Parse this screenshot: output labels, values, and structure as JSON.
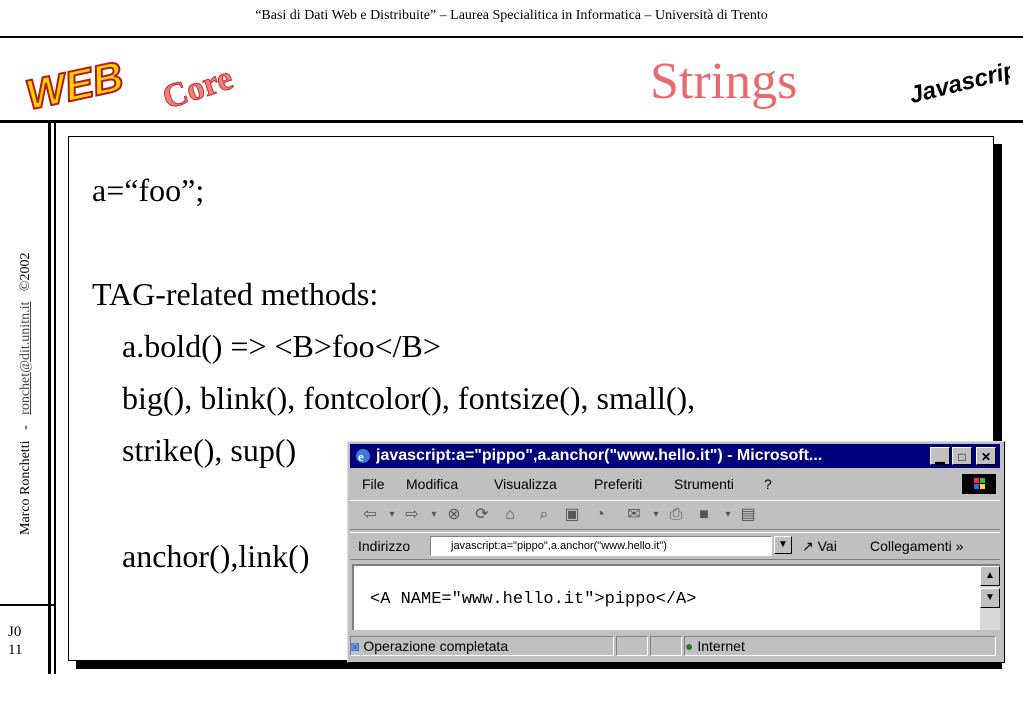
{
  "header": {
    "course_title": "“Basi di Dati Web e Distribuite” – Laurea Specialitica in Informatica – Università di Trento",
    "logo_web": "WEB",
    "logo_core": "Core",
    "slide_title": "Strings",
    "logo_javascript": "Javascript"
  },
  "sidebar": {
    "author": "Marco Ronchetti",
    "separator": "-",
    "email": "ronchet@dit.unitn.it",
    "copyright": "©2002",
    "page_code": "J0",
    "page_number": "11"
  },
  "content": {
    "lines": [
      "a=“foo”;",
      "TAG-related methods:",
      "a.bold() => <B>foo</B>",
      "big(), blink(), fontcolor(), fontsize(), small(),",
      "strike(), sup()",
      "anchor(),link()"
    ]
  },
  "browser": {
    "window_title": "javascript:a=\"pippo\",a.anchor(\"www.hello.it\") - Microsoft...",
    "menu": [
      "File",
      "Modifica",
      "Visualizza",
      "Preferiti",
      "Strumenti",
      "?"
    ],
    "address_label": "Indirizzo",
    "address_value": "javascript:a=\"pippo\",a.anchor(\"www.hello.it\")",
    "go_label": "Vai",
    "links_label": "Collegamenti »",
    "document_text": "<A NAME=\"www.hello.it\">pippo</A>",
    "status_text": "Operazione completata",
    "zone_text": "Internet"
  },
  "colors": {
    "title": "#e8696e",
    "titlebar": "#00007b",
    "window": "#c0c0c0"
  }
}
